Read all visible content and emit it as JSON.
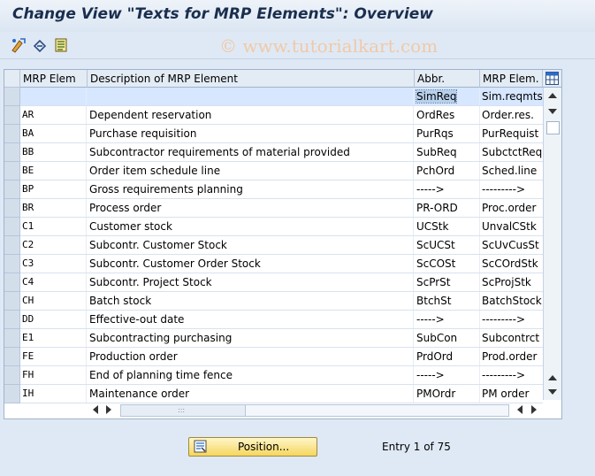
{
  "title": "Change View \"Texts for MRP Elements\": Overview",
  "watermark": "© www.tutorialkart.com",
  "columns": {
    "key": "MRP Elem",
    "desc": "Description of MRP Element",
    "abbr": "Abbr.",
    "mrp": "MRP Elem."
  },
  "rows": [
    {
      "key": "",
      "desc": "",
      "abbr": "SimReq",
      "mrp": "Sim.reqmts"
    },
    {
      "key": "AR",
      "desc": "Dependent reservation",
      "abbr": "OrdRes",
      "mrp": "Order.res."
    },
    {
      "key": "BA",
      "desc": "Purchase requisition",
      "abbr": "PurRqs",
      "mrp": "PurRequist"
    },
    {
      "key": "BB",
      "desc": "Subcontractor requirements of material provided",
      "abbr": "SubReq",
      "mrp": "SubctctReq"
    },
    {
      "key": "BE",
      "desc": "Order item schedule line",
      "abbr": "PchOrd",
      "mrp": "Sched.line"
    },
    {
      "key": "BP",
      "desc": "Gross requirements planning",
      "abbr": "----->",
      "mrp": "--------->"
    },
    {
      "key": "BR",
      "desc": "Process order",
      "abbr": "PR-ORD",
      "mrp": "Proc.order"
    },
    {
      "key": "C1",
      "desc": "Customer stock",
      "abbr": "UCStk",
      "mrp": "UnvalCStk"
    },
    {
      "key": "C2",
      "desc": "Subcontr. Customer Stock",
      "abbr": "ScUCSt",
      "mrp": "ScUvCusSt"
    },
    {
      "key": "C3",
      "desc": "Subcontr. Customer Order Stock",
      "abbr": "ScCOSt",
      "mrp": "ScCOrdStk"
    },
    {
      "key": "C4",
      "desc": "Subcontr. Project Stock",
      "abbr": "ScPrSt",
      "mrp": "ScProjStk"
    },
    {
      "key": "CH",
      "desc": "Batch stock",
      "abbr": "BtchSt",
      "mrp": "BatchStock"
    },
    {
      "key": "DD",
      "desc": "Effective-out date",
      "abbr": "----->",
      "mrp": "--------->"
    },
    {
      "key": "E1",
      "desc": "Subcontracting purchasing",
      "abbr": "SubCon",
      "mrp": "Subcontrct"
    },
    {
      "key": "FE",
      "desc": "Production order",
      "abbr": "PrdOrd",
      "mrp": "Prod.order"
    },
    {
      "key": "FH",
      "desc": "End of planning time fence",
      "abbr": "----->",
      "mrp": "--------->"
    },
    {
      "key": "IH",
      "desc": "Maintenance order",
      "abbr": "PMOrdr",
      "mrp": "PM order"
    }
  ],
  "position_button": "Position...",
  "entry_info": "Entry 1 of 75",
  "icons": {
    "toolbar": [
      "display-change-icon",
      "other-entry-icon",
      "details-icon"
    ],
    "table_settings": "column-config-icon"
  },
  "colors": {
    "accent": "#1a2e4e",
    "background": "#dfe9f5",
    "button": "#f5d65f"
  }
}
